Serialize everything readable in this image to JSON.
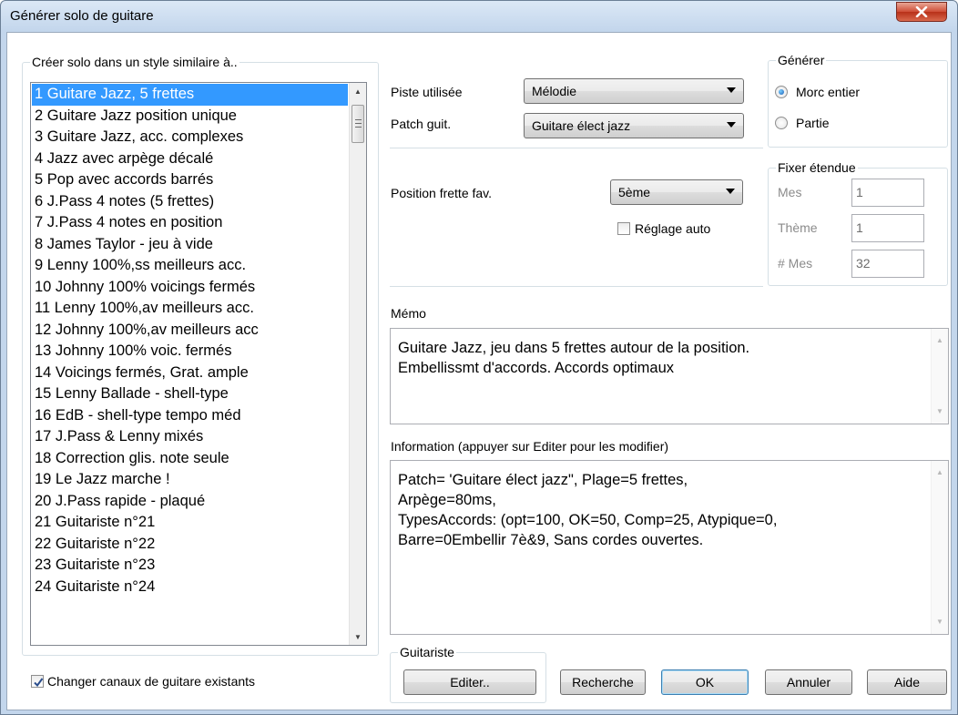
{
  "window": {
    "title": "Générer solo de guitare"
  },
  "list_group": {
    "label": "Créer solo dans un style similaire à..",
    "items": [
      "1 Guitare Jazz, 5 frettes",
      "2 Guitare Jazz position unique",
      "3 Guitare Jazz, acc. complexes",
      "4 Jazz avec arpège décalé",
      "5 Pop avec accords barrés",
      "6 J.Pass 4 notes (5 frettes)",
      "7 J.Pass 4 notes en position",
      "8 James Taylor - jeu à vide",
      "9 Lenny 100%,ss meilleurs acc.",
      "10 Johnny 100% voicings fermés",
      "11 Lenny 100%,av meilleurs acc.",
      "12 Johnny 100%,av meilleurs acc",
      "13 Johnny 100% voic. fermés",
      "14 Voicings fermés, Grat. ample",
      "15 Lenny Ballade - shell-type",
      "16 EdB - shell-type tempo méd",
      "17 J.Pass & Lenny mixés",
      "18 Correction glis. note seule",
      "19 Le Jazz marche !",
      "20 J.Pass rapide - plaqué",
      "21 Guitariste n°21",
      "22 Guitariste n°22",
      "23 Guitariste n°23",
      "24 Guitariste n°24"
    ],
    "selected_index": 0
  },
  "track": {
    "label": "Piste utilisée",
    "value": "Mélodie"
  },
  "patch": {
    "label": "Patch guit.",
    "value": "Guitare élect jazz"
  },
  "fret": {
    "label": "Position frette fav.",
    "value": "5ème"
  },
  "auto": {
    "label": "Réglage auto",
    "checked": false
  },
  "generate": {
    "label": "Générer",
    "options": [
      {
        "label": "Morc entier",
        "checked": true
      },
      {
        "label": "Partie",
        "checked": false
      }
    ]
  },
  "range": {
    "label": "Fixer étendue",
    "fields": [
      {
        "label": "Mes",
        "value": "1"
      },
      {
        "label": "Thème",
        "value": "1"
      },
      {
        "label": "# Mes",
        "value": "32"
      }
    ]
  },
  "memo": {
    "label": "Mémo",
    "lines": [
      "Guitare Jazz, jeu dans 5 frettes autour de la position.",
      "Embellissmt d'accords. Accords optimaux"
    ]
  },
  "info": {
    "label": "Information (appuyer sur Editer pour les modifier)",
    "lines": [
      "Patch= 'Guitare élect jazz\", Plage=5 frettes,",
      "Arpège=80ms,",
      "TypesAccords: (opt=100, OK=50, Comp=25, Atypique=0,",
      "Barre=0Embellir 7è&9, Sans cordes ouvertes."
    ]
  },
  "change_channels": {
    "label": "Changer canaux de guitare existants",
    "checked": true
  },
  "guitarist": {
    "label": "Guitariste",
    "edit_label": "Editer.."
  },
  "buttons": {
    "search": "Recherche",
    "ok": "OK",
    "cancel": "Annuler",
    "help": "Aide"
  }
}
